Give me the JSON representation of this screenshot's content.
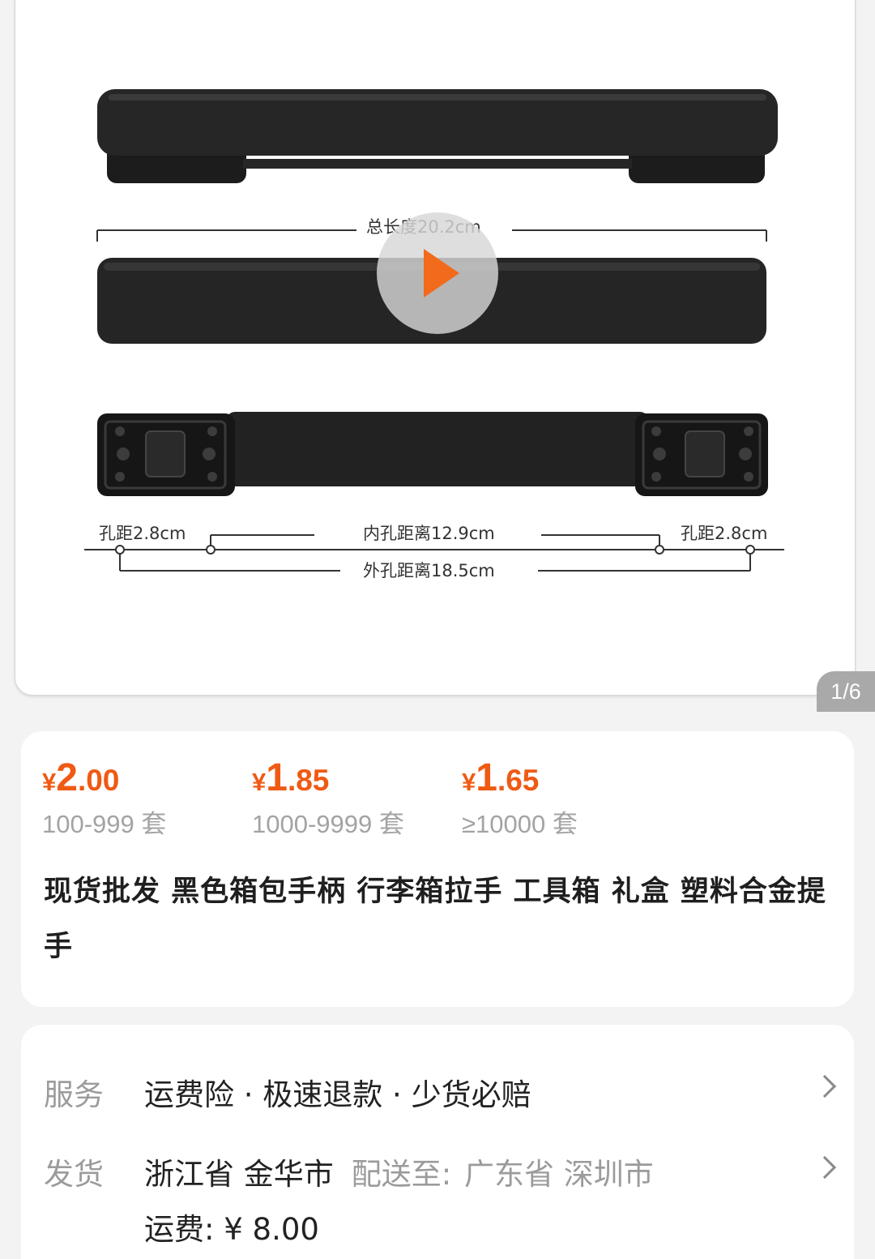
{
  "gallery": {
    "labels": {
      "total_length": "总长度20.2cm",
      "hole_left": "孔距2.8cm",
      "inner_distance": "内孔距离12.9cm",
      "hole_right": "孔距2.8cm",
      "outer_distance": "外孔距离18.5cm"
    },
    "page_indicator": "1/6"
  },
  "prices": [
    {
      "currency": "¥",
      "int": "2",
      "dec": ".00",
      "qty": "100-999 套"
    },
    {
      "currency": "¥",
      "int": "1",
      "dec": ".85",
      "qty": "1000-9999 套"
    },
    {
      "currency": "¥",
      "int": "1",
      "dec": ".65",
      "qty": "≥10000 套"
    }
  ],
  "product": {
    "title": "现货批发 黑色箱包手柄 行李箱拉手 工具箱 礼盒 塑料合金提手"
  },
  "service": {
    "label": "服务",
    "value": "运费险 · 极速退款 · 少货必赔"
  },
  "shipping": {
    "label": "发货",
    "origin": "浙江省 金华市",
    "dest_label": "配送至:",
    "dest": "广东省 深圳市",
    "fee": "运费: ¥ 8.00"
  },
  "colors": {
    "accent": "#ef5a14",
    "play": "#f26a1b"
  }
}
